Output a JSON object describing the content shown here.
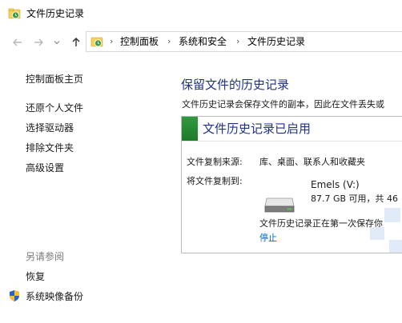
{
  "window": {
    "title": "文件历史记录"
  },
  "address": {
    "crumbs": [
      "控制面板",
      "系统和安全",
      "文件历史记录"
    ]
  },
  "leftnav": {
    "home": "控制面板主页",
    "items": [
      "还原个人文件",
      "选择驱动器",
      "排除文件夹",
      "高级设置"
    ],
    "see_also_header": "另请参阅",
    "see_also": [
      "恢复",
      "系统映像备份"
    ]
  },
  "main": {
    "title": "保留文件的历史记录",
    "description": "文件历史记录会保存文件的副本，因此在文件丢失或",
    "status": "文件历史记录已启用",
    "source_label": "文件复制来源:",
    "source_value": "库、桌面、联系人和收藏夹",
    "dest_label": "将文件复制到:",
    "drive_name": "Emels (V:)",
    "drive_space": "87.7 GB 可用，共 46",
    "progress_text": "文件历史记录正在第一次保存你",
    "stop_link": "停止"
  },
  "colors": {
    "title_blue": "#1e3287",
    "link_blue": "#0066cc",
    "status_green": "#2f9a3f"
  }
}
